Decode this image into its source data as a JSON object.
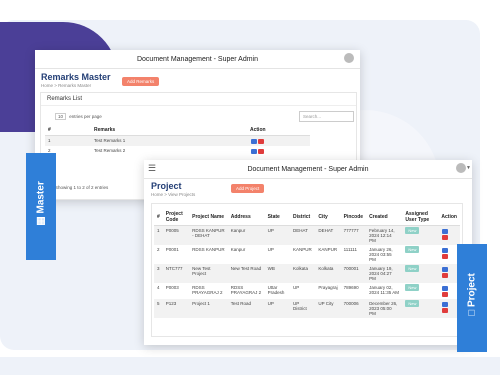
{
  "app": {
    "title": "Document Management - Super Admin"
  },
  "remarks": {
    "page_title": "Remarks Master",
    "breadcrumb": "Home > Remarks Master",
    "add_button": "Add Remarks",
    "card_title": "Remarks List",
    "entries_value": "10",
    "entries_label": "entries per page",
    "search_placeholder": "Search...",
    "columns": [
      "#",
      "Remarks",
      "Action"
    ],
    "rows": [
      {
        "num": "1",
        "remark": "Test Remarks 1"
      },
      {
        "num": "2",
        "remark": "Test Remarks 2"
      }
    ],
    "footer": "Showing 1 to 2 of 2 entries"
  },
  "project": {
    "page_title": "Project",
    "breadcrumb": "Home > View Projects",
    "add_button": "Add Project",
    "columns": [
      "#",
      "Project Code",
      "Project Name",
      "Address",
      "State",
      "District",
      "City",
      "Pincode",
      "Created",
      "Assigned User Type",
      "Action"
    ],
    "rows": [
      {
        "num": "1",
        "code": "P0005",
        "name": "RDSS KANPUR - DEHAT",
        "address": "Kanpur",
        "state": "UP",
        "district": "DEHAT",
        "city": "DEHAT",
        "pincode": "777777",
        "created": "February 14, 2024 12:14 PM",
        "assigned": "New"
      },
      {
        "num": "2",
        "code": "P0001",
        "name": "RDSS KANPUR",
        "address": "Kanpur",
        "state": "UP",
        "district": "KANPUR",
        "city": "KANPUR",
        "pincode": "111111",
        "created": "January 26, 2024 03:55 PM",
        "assigned": "New"
      },
      {
        "num": "3",
        "code": "NTC777",
        "name": "New Test Project",
        "address": "New Test Road",
        "state": "WB",
        "district": "Kolkata",
        "city": "Kolkata",
        "pincode": "700001",
        "created": "January 19, 2024 04:27 PM",
        "assigned": "New"
      },
      {
        "num": "4",
        "code": "P0003",
        "name": "RDSS PRAYAGRAJ 2",
        "address": "RDSS PRAYAGRAJ 2",
        "state": "Uttar Pradesh",
        "district": "UP",
        "city": "Prayagraj",
        "pincode": "789690",
        "created": "January 02, 2024 11:35 AM",
        "assigned": "New"
      },
      {
        "num": "5",
        "code": "P123",
        "name": "Project 1",
        "address": "Test Road",
        "state": "UP",
        "district": "UP District",
        "city": "UP City",
        "pincode": "700006",
        "created": "December 26, 2023 05:00 PM",
        "assigned": "New"
      }
    ]
  },
  "side_tabs": {
    "master": "Master",
    "project": "Project"
  },
  "colors": {
    "accent": "#2f7fd8",
    "orange": "#f3826b",
    "purple": "#4b3f97",
    "title": "#233e75"
  }
}
